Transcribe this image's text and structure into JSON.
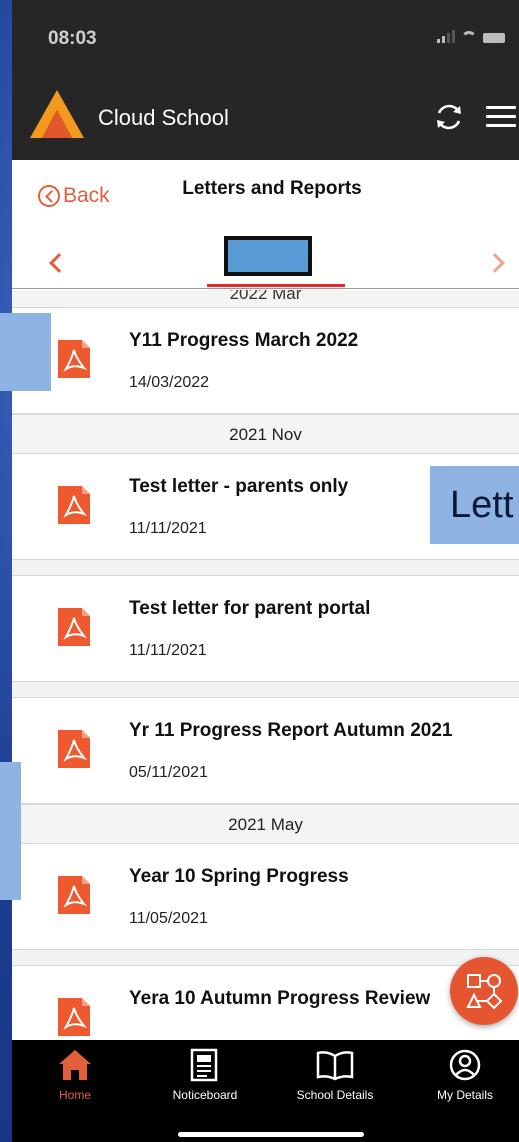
{
  "status_bar": {
    "time": "08:03"
  },
  "header": {
    "app_name": "Cloud School"
  },
  "page": {
    "back_label": "Back",
    "title": "Letters and Reports"
  },
  "list": {
    "top_cut_label": "2022 Mar",
    "items": [
      {
        "title": "Y11 Progress March 2022",
        "date": "14/03/2022"
      },
      {
        "section": "2021 Nov"
      },
      {
        "title": "Test letter - parents only",
        "date": "11/11/2021"
      },
      {
        "title": "Test letter for parent portal",
        "date": "11/11/2021"
      },
      {
        "title": "Yr 11 Progress Report Autumn 2021",
        "date": "05/11/2021"
      },
      {
        "section": "2021 May"
      },
      {
        "title": "Year 10 Spring Progress",
        "date": "11/05/2021"
      },
      {
        "title": "Yera 10 Autumn Progress Review"
      }
    ]
  },
  "overlay": {
    "text": "Lett"
  },
  "tabs": [
    {
      "label": "Home",
      "icon": "home-icon",
      "active": true
    },
    {
      "label": "Noticeboard",
      "icon": "noticeboard-icon"
    },
    {
      "label": "School Details",
      "icon": "book-icon"
    },
    {
      "label": "My Details",
      "icon": "user-circle-icon"
    }
  ],
  "colors": {
    "accent": "#e0603c",
    "header_bg": "#262626",
    "tab_bar_bg": "#000000"
  }
}
